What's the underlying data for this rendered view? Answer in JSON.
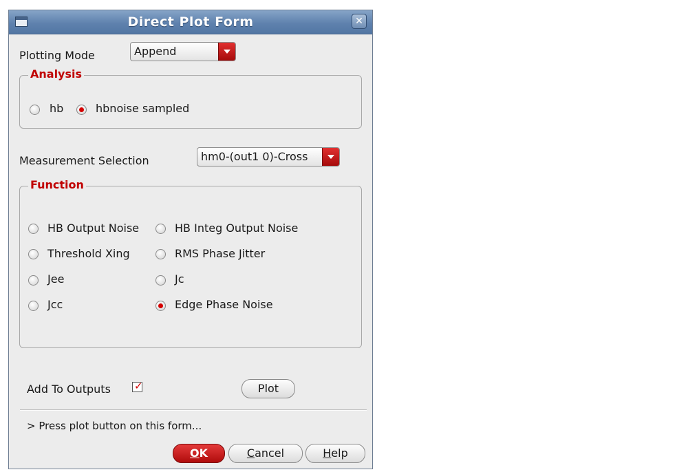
{
  "window": {
    "title": "Direct Plot Form"
  },
  "plotting_mode": {
    "label": "Plotting Mode",
    "value": "Append"
  },
  "analysis": {
    "legend": "Analysis",
    "options": [
      {
        "label": "hb",
        "selected": false
      },
      {
        "label": "hbnoise sampled",
        "selected": true
      }
    ]
  },
  "measurement": {
    "label": "Measurement Selection",
    "value": "hm0-(out1 0)-Cross"
  },
  "function": {
    "legend": "Function",
    "options": [
      {
        "label": "HB Output Noise",
        "selected": false
      },
      {
        "label": "HB Integ Output Noise",
        "selected": false
      },
      {
        "label": "Threshold Xing",
        "selected": false
      },
      {
        "label": "RMS Phase Jitter",
        "selected": false
      },
      {
        "label": "Jee",
        "selected": false
      },
      {
        "label": "Jc",
        "selected": false
      },
      {
        "label": "Jcc",
        "selected": false
      },
      {
        "label": "Edge Phase Noise",
        "selected": true
      }
    ]
  },
  "add_to_outputs": {
    "label": "Add To Outputs",
    "checked": true
  },
  "plot_button": "Plot",
  "status": "> Press plot button on this form...",
  "buttons": {
    "ok": {
      "mnemonic": "O",
      "rest": "K"
    },
    "cancel": {
      "mnemonic": "C",
      "rest": "ancel"
    },
    "help": {
      "mnemonic": "H",
      "rest": "elp"
    }
  },
  "colors": {
    "accent_red": "#d40000",
    "titlebar_blue": "#5f82ae"
  }
}
